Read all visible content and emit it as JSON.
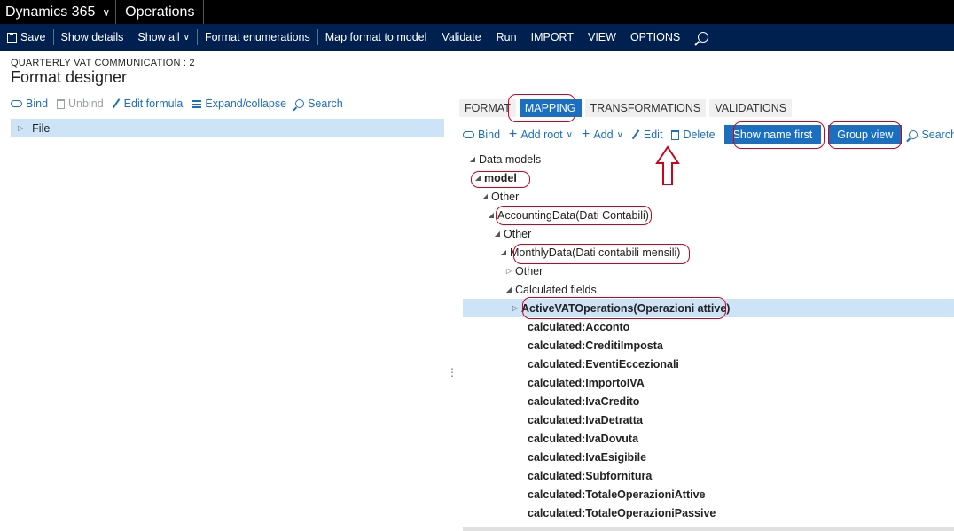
{
  "topbar": {
    "brand": "Dynamics 365",
    "module": "Operations"
  },
  "actionbar": {
    "items": [
      "Save",
      "Show details",
      "Show all",
      "Format enumerations",
      "Map format to model",
      "Validate",
      "Run",
      "IMPORT",
      "VIEW",
      "OPTIONS"
    ]
  },
  "page": {
    "caption": "QUARTERLY VAT COMMUNICATION : 2",
    "title": "Format designer"
  },
  "left_toolbar": {
    "bind": "Bind",
    "unbind": "Unbind",
    "edit_formula": "Edit formula",
    "expand_collapse": "Expand/collapse",
    "search": "Search"
  },
  "left_tree": {
    "root": "File"
  },
  "tabs": [
    "FORMAT",
    "MAPPING",
    "TRANSFORMATIONS",
    "VALIDATIONS"
  ],
  "right_toolbar": {
    "bind": "Bind",
    "add_root": "Add root",
    "add": "Add",
    "edit": "Edit",
    "delete": "Delete",
    "show_name_first": "Show name first",
    "group_view": "Group view",
    "search": "Search"
  },
  "tree": [
    "Data models",
    "model",
    "Other",
    "AccountingData(Dati Contabili)",
    "Other",
    "MonthlyData(Dati contabili mensili)",
    "Other",
    "Calculated fields",
    "ActiveVATOperations(Operazioni attive)",
    "calculated:Acconto",
    "calculated:CreditiImposta",
    "calculated:EventiEccezionali",
    "calculated:ImportoIVA",
    "calculated:IvaCredito",
    "calculated:IvaDetratta",
    "calculated:IvaDovuta",
    "calculated:IvaEsigibile",
    "calculated:Subfornitura",
    "calculated:TotaleOperazioniAttive",
    "calculated:TotaleOperazioniPassive"
  ],
  "colors": {
    "navy": "#002050",
    "accent": "#1a6fc0",
    "selection": "#cde3f7",
    "annotation": "#d0021b"
  }
}
